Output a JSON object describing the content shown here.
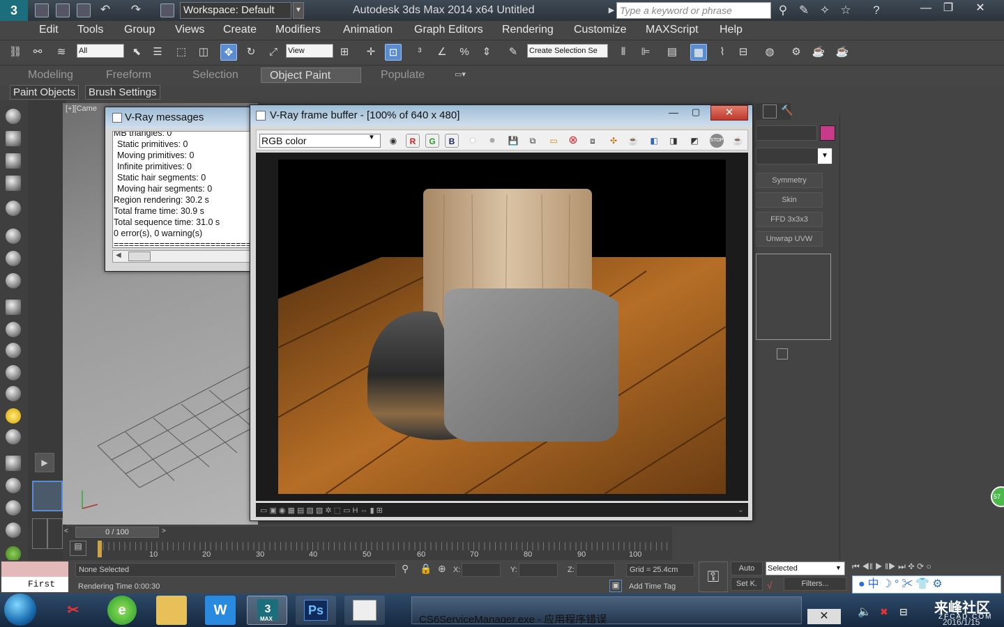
{
  "titlebar": {
    "workspace": "Workspace: Default",
    "app_title": "Autodesk 3ds Max  2014 x64     Untitled",
    "search_placeholder": "Type a keyword or phrase"
  },
  "menu": [
    "Edit",
    "Tools",
    "Group",
    "Views",
    "Create",
    "Modifiers",
    "Animation",
    "Graph Editors",
    "Rendering",
    "Customize",
    "MAXScript",
    "Help"
  ],
  "toolbar": {
    "filter": "All",
    "ref_coord": "View",
    "selection_set": "Create Selection Se"
  },
  "ribbon": {
    "tabs": [
      "Modeling",
      "Freeform",
      "Selection",
      "Object Paint",
      "Populate"
    ],
    "subtabs": [
      "Paint Objects",
      "Brush Settings"
    ]
  },
  "viewport": {
    "label": "[+][Came"
  },
  "vray_messages": {
    "title": "V-Ray messages",
    "lines": [
      "MB triangles: 0",
      "Static primitives: 0",
      "Moving primitives: 0",
      "Infinite primitives: 0",
      "Static hair segments: 0",
      "Moving hair segments: 0",
      "Region rendering: 30.2 s",
      "Total frame time: 30.9 s",
      "Total sequence time: 31.0 s",
      "0 error(s), 0 warning(s)",
      "================================"
    ]
  },
  "frame_buffer": {
    "title": "V-Ray frame buffer - [100% of 640 x 480]",
    "channel": "RGB color",
    "r": "R",
    "g": "G",
    "b": "B"
  },
  "modifiers": [
    "Symmetry",
    "Skin",
    "FFD 3x3x3",
    "Unwrap UVW"
  ],
  "timeline": {
    "slider": "0 / 100",
    "ticks": [
      "10",
      "20",
      "30",
      "40",
      "50",
      "60",
      "70",
      "80",
      "90",
      "100"
    ]
  },
  "status": {
    "selection": "None Selected",
    "render_time": "Rendering Time  0:00:30",
    "x_label": "X:",
    "y_label": "Y:",
    "z_label": "Z:",
    "grid": "Grid = 25.4cm",
    "add_time_tag": "Add Time Tag",
    "auto": "Auto",
    "set_key": "Set K.",
    "key_mode": "Selected",
    "filters": "Filters...",
    "maxscript": "First"
  },
  "taskbar": {
    "error_window": "CS6ServiceManager.exe - 应用程序错误",
    "max_label": "MAX",
    "watermark": "来峰社区",
    "watermark_sub": "ZFCAD.COM",
    "date": "2016/1/15"
  },
  "colors": {
    "accent": "#5a8ccf",
    "titlebar": "#2c343c",
    "panel": "#464646",
    "swatch": "#c83a8a"
  }
}
